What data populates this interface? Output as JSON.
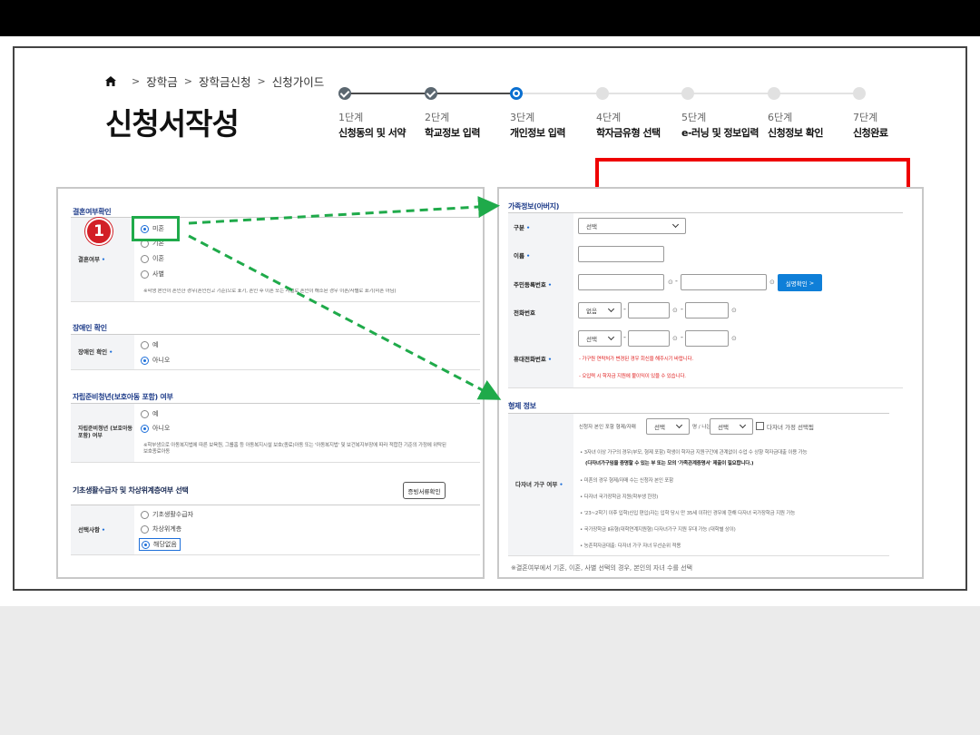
{
  "breadcrumb": {
    "items": [
      "장학금",
      "장학금신청",
      "신청가이드"
    ]
  },
  "page_title": "신청서작성",
  "stepper": {
    "steps": [
      {
        "num": "1단계",
        "name": "신청동의 및 서약",
        "state": "done"
      },
      {
        "num": "2단계",
        "name": "학교정보 입력",
        "state": "done"
      },
      {
        "num": "3단계",
        "name": "개인정보 입력",
        "state": "current"
      },
      {
        "num": "4단계",
        "name": "학자금유형 선택",
        "state": "todo"
      },
      {
        "num": "5단계",
        "name": "e-러닝 및 정보입력",
        "state": "todo"
      },
      {
        "num": "6단계",
        "name": "신청정보 확인",
        "state": "todo"
      },
      {
        "num": "7단계",
        "name": "신청완료",
        "state": "todo"
      }
    ]
  },
  "marker": {
    "number": "1"
  },
  "left": {
    "marriage": {
      "title": "결혼여부확인",
      "label": "결혼여부",
      "options": [
        "미혼",
        "기혼",
        "이혼",
        "사별"
      ],
      "selected": "미혼",
      "note": "※학생 본인이 혼인한 경우(혼인신고 기준)으로 표기, 혼인 후 이혼 또는 사별로 혼인이 해소된 경우 이혼/사별로 표기(미혼 아님)"
    },
    "disability": {
      "title": "장애인 확인",
      "label": "장애인 확인",
      "options": [
        "예",
        "아니오"
      ],
      "selected": "아니오"
    },
    "youth": {
      "title": "자립준비청년(보호아동 포함) 여부",
      "label": "자립준비청년 (보호아동 포함) 여부",
      "options": [
        "예",
        "아니오"
      ],
      "selected": "아니오",
      "note": "※학부생으로 아동복지법에 따른 보육원, 그룹홈 등 아동복지시설 보호(종료)아동 또는 '아동복지법' 및 보건복지부장에 따라 적합한 기준의 가정에 위탁된 보호종료아동"
    },
    "basic": {
      "title": "기초생활수급자 및 차상위계층여부 선택",
      "button": "증빙서류확인",
      "label": "선택사항",
      "options": [
        "기초생활수급자",
        "차상위계층",
        "해당없음"
      ],
      "selected": "해당없음"
    }
  },
  "right": {
    "family": {
      "title": "가족정보(아버지)",
      "fields": {
        "type_label": "구분",
        "type_value": "선택",
        "name_label": "이름",
        "rrn_label": "주민등록번호",
        "verify_button": "실명확인",
        "phone_label": "전화번호",
        "phone_prefix": "없음",
        "mobile_label": "휴대전화번호",
        "mobile_prefix": "선택",
        "mobile_note1": "- 가구원 연락처가 변경된 경우 회신을 해주시기 바랍니다.",
        "mobile_note2": "- 오입력 시 학자금 지원에 불이익이 있을 수 있습니다."
      }
    },
    "sibling": {
      "title": "형제 정보",
      "label": "다자녀 가구 여부",
      "line_text": "신청자 본인 포함 형제/자매",
      "select1": "선택",
      "middle_text": "명 / 나는",
      "select2": "선택",
      "checkbox_label": "다자녀 가정 선택됨",
      "bullets": [
        "3자녀 이상 가구의 경우(부모, 형제 포함) 학생이 학자금 지원구간에 관계없이 수업 수 상향 학자금대출 이용 가능",
        "(다자녀가구임을 증명할 수 있는 부 또는 모의 '가족관계증명서' 제출이 필요합니다.)",
        "미혼의 경우 형제/자매 수는 신청자 본인 포함",
        "다자녀 국가장학금 지원(학부생 한정)",
        "'23~2학기 이후 입학(신입 편입)자는 입학 당시 만 35세 이하인 경우에 한해 다자녀 국가장학금 지원 가능",
        "국가장학금 Ⅱ유형(대학연계지원형) 다자녀가구 지원 우대 가능 (대학별 상이)",
        "농촌학자금대출: 다자녀 가구 자녀 우선순위 적용"
      ]
    },
    "footnote": "※결혼여부에서 기혼, 이혼, 사별 선택의 경우, 본인의 자녀 수를 선택"
  },
  "colors": {
    "accent_blue": "#0f7fd8",
    "highlight_green": "#1faa4a",
    "marker_red": "#d21f26",
    "red_box": "#ee0000"
  }
}
